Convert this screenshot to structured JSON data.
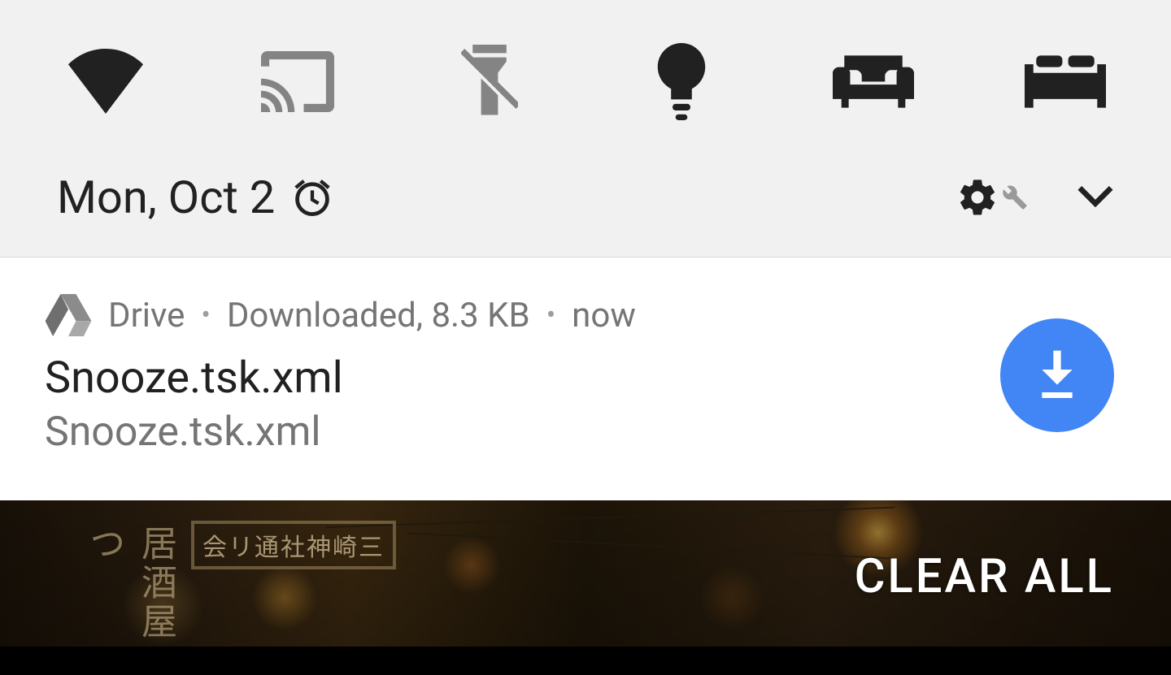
{
  "quick_settings": {
    "date": "Mon, Oct 2",
    "tiles": [
      {
        "name": "wifi",
        "active": true
      },
      {
        "name": "cast",
        "active": false
      },
      {
        "name": "flashlight",
        "active": false
      },
      {
        "name": "bulb",
        "active": true
      },
      {
        "name": "couch",
        "active": true
      },
      {
        "name": "bed",
        "active": true
      }
    ]
  },
  "notification": {
    "app": "Drive",
    "status": "Downloaded, 8.3 KB",
    "time": "now",
    "title": "Snooze.tsk.xml",
    "subtitle": "Snooze.tsk.xml"
  },
  "actions": {
    "clear_all": "CLEAR ALL"
  },
  "wallpaper": {
    "sign_vertical": "居酒屋つ",
    "sign_box": "会リ通社神崎三"
  }
}
